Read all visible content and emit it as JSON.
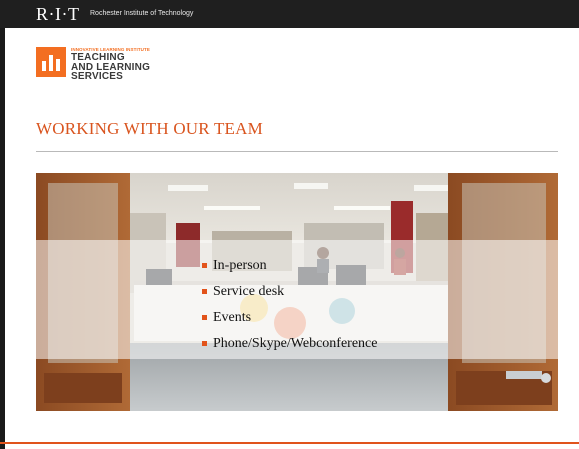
{
  "header": {
    "logo": "R·I·T",
    "institution": "Rochester Institute of Technology"
  },
  "branding": {
    "small_text": "INNOVATIVE LEARNING INSTITUTE",
    "lines": [
      "TEACHING",
      "AND LEARNING",
      "SERVICES"
    ],
    "accent": "#f36e21"
  },
  "slide": {
    "title": "WORKING WITH OUR TEAM",
    "title_color": "#d9541e"
  },
  "bullets": [
    "In-person",
    "Service desk",
    "Events",
    "Phone/Skype/Webconference"
  ],
  "colors": {
    "topbar": "#1f1f1f",
    "bullet_marker": "#e2531a",
    "footer_rule": "#e0531c"
  }
}
